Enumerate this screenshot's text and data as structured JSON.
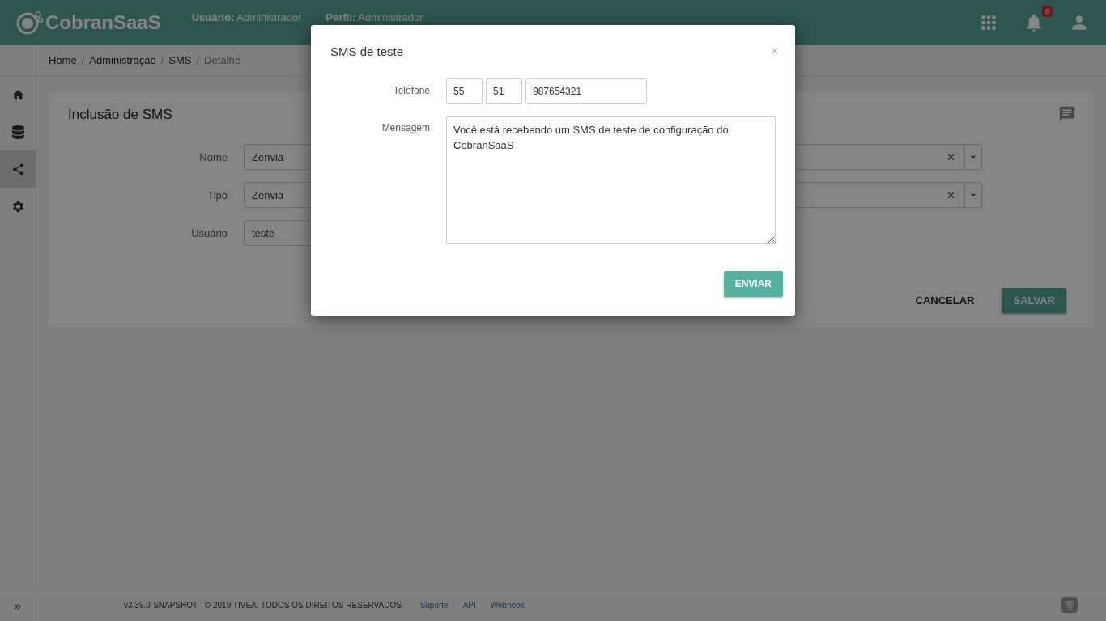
{
  "header": {
    "logo": "CobranSaaS",
    "user_label": "Usuário:",
    "user_value": "Administrador",
    "profile_label": "Perfil:",
    "profile_value": "Administrador",
    "notification_count": "6"
  },
  "breadcrumb": {
    "separator": "/",
    "items": [
      {
        "label": "Home",
        "current": false
      },
      {
        "label": "Administração",
        "current": false
      },
      {
        "label": "SMS",
        "current": false
      },
      {
        "label": "Detalhe",
        "current": true
      }
    ]
  },
  "sidebar": {
    "items": [
      {
        "selected": false
      },
      {
        "selected": false
      },
      {
        "selected": true
      },
      {
        "selected": false
      }
    ]
  },
  "card": {
    "title": "Inclusão de SMS",
    "fields": [
      {
        "label": "Nome",
        "value": "Zenvia",
        "kind": "select"
      },
      {
        "label": "Tipo",
        "value": "Zenvia",
        "kind": "select"
      },
      {
        "label": "Usuário",
        "value": "teste",
        "kind": "text"
      }
    ],
    "buttons": [
      {
        "label": "CANCELAR",
        "kind": "flat"
      },
      {
        "label": "SALVAR",
        "kind": "raised"
      }
    ]
  },
  "footer": {
    "expand": "»",
    "text": "v3.39.0-SNAPSHOT - © 2019 TIVEA. TODOS OS DIREITOS RESERVADOS.",
    "links": [
      "Suporte",
      "API",
      "Webhook"
    ]
  },
  "modal": {
    "title": "SMS de teste",
    "close": "×",
    "phone_label": "Telefone",
    "phone": [
      "55",
      "51",
      "987654321"
    ],
    "message_label": "Mensagem",
    "message": "Você está recebendo um SMS de teste de configuração do CobranSaaS",
    "button": "ENVIAR"
  }
}
